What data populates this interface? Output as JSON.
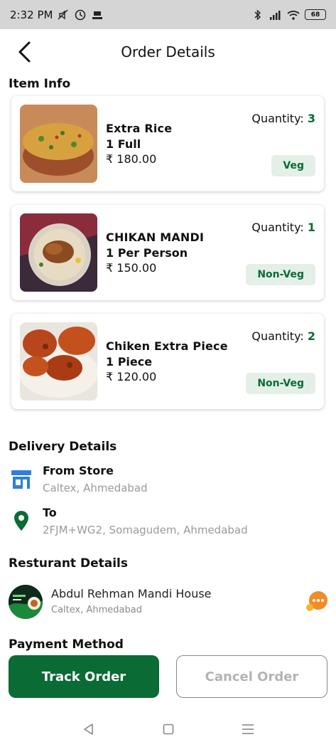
{
  "status_bar": {
    "time": "2:32 PM",
    "battery": "68"
  },
  "header": {
    "title": "Order Details",
    "back_icon": "arrow-back-icon"
  },
  "item_info": {
    "title": "Item Info",
    "quantity_label": "Quantity:",
    "items": [
      {
        "name": "Extra Rice",
        "variant": "1 Full",
        "price": "₹ 180.00",
        "quantity": "3",
        "tag": "Veg"
      },
      {
        "name": "CHIKAN MANDI",
        "variant": "1 Per Person",
        "price": "₹ 150.00",
        "quantity": "1",
        "tag": "Non-Veg"
      },
      {
        "name": "Chiken Extra Piece",
        "variant": "1 Piece",
        "price": "₹ 120.00",
        "quantity": "2",
        "tag": "Non-Veg"
      }
    ]
  },
  "delivery": {
    "title": "Delivery Details",
    "from_label": "From Store",
    "from_value": "Caltex, Ahmedabad",
    "to_label": "To",
    "to_value": "2FJM+WG2, Somagudem, Ahmedabad"
  },
  "restaurant": {
    "title": "Resturant Details",
    "name": "Abdul Rehman Mandi House",
    "location": "Caltex, Ahmedabad"
  },
  "payment": {
    "title": "Payment Method"
  },
  "actions": {
    "track": "Track Order",
    "cancel": "Cancel Order"
  },
  "colors": {
    "primary": "#0b6b35",
    "tag_bg": "#e3efe7",
    "muted": "#9a9a9a",
    "status_bar": "#d5d5d5",
    "store_icon": "#2f7fd8",
    "chat_icon": "#f28c28"
  }
}
